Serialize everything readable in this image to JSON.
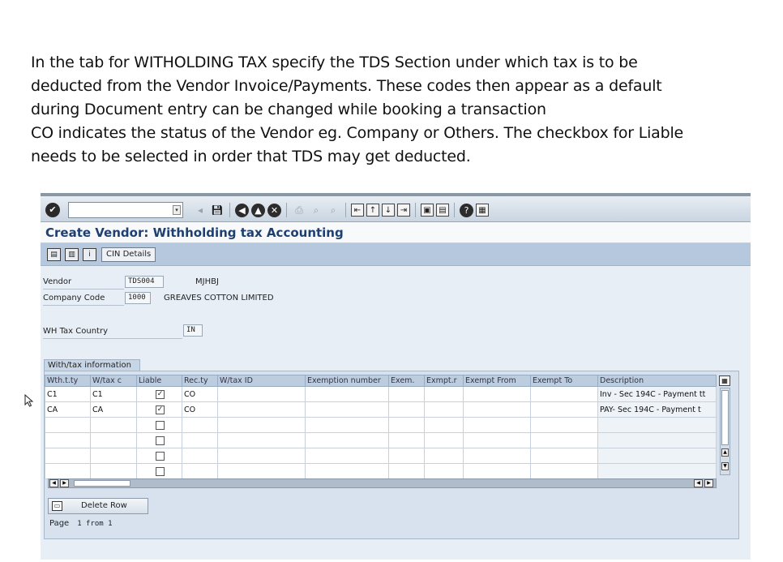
{
  "caption": {
    "lines": [
      "In the tab for WITHOLDING TAX specify the TDS Section under which tax is to be",
      "deducted from the Vendor Invoice/Payments. These codes then appear as a default",
      "during Document entry  can be changed while booking a transaction",
      "CO indicates the status of the Vendor eg. Company or Others. The checkbox for Liable",
      "needs to be selected in order that TDS may get deducted."
    ]
  },
  "window": {
    "title": "Create Vendor: Withholding tax Accounting",
    "cin_button": "CIN Details",
    "command_field": ""
  },
  "form": {
    "vendor_label": "Vendor",
    "vendor_value": "TDS004",
    "vendor_name": "MJHBJ",
    "company_code_label": "Company Code",
    "company_code_value": "1000",
    "company_name": "GREAVES COTTON LIMITED",
    "wh_tax_country_label": "WH Tax Country",
    "wh_tax_country_value": "IN"
  },
  "withholding": {
    "group_title": "With/tax information",
    "columns": [
      "Wth.t.ty",
      "W/tax c",
      "Liable",
      "Rec.ty",
      "W/tax ID",
      "Exemption number",
      "Exem.",
      "Exmpt.r",
      "Exempt From",
      "Exempt To",
      "Description"
    ],
    "rows": [
      [
        "C1",
        "C1",
        true,
        "CO",
        "",
        "",
        "",
        "",
        "",
        "",
        "Inv - Sec 194C - Payment tt"
      ],
      [
        "CA",
        "CA",
        true,
        "CO",
        "",
        "",
        "",
        "",
        "",
        "",
        "PAY- Sec 194C - Payment t"
      ],
      [
        "",
        "",
        false,
        "",
        "",
        "",
        "",
        "",
        "",
        "",
        ""
      ],
      [
        "",
        "",
        false,
        "",
        "",
        "",
        "",
        "",
        "",
        "",
        ""
      ],
      [
        "",
        "",
        false,
        "",
        "",
        "",
        "",
        "",
        "",
        "",
        ""
      ],
      [
        "",
        "",
        false,
        "",
        "",
        "",
        "",
        "",
        "",
        "",
        ""
      ]
    ]
  },
  "footer": {
    "delete_row_label": "Delete Row",
    "page_label": "Page",
    "page_value": "1 from 1"
  }
}
